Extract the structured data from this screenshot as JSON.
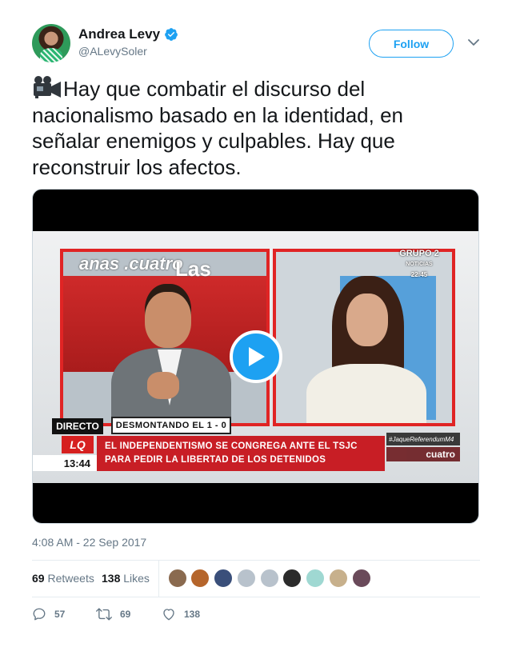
{
  "author": {
    "display_name": "Andrea Levy",
    "handle": "@ALevySoler",
    "verified_icon": "verified-badge-icon",
    "avatar_icon": "profile-avatar"
  },
  "header": {
    "follow_label": "Follow",
    "menu_icon": "chevron-down-icon"
  },
  "tweet": {
    "emoji_icon": "movie-camera-icon",
    "text": "Hay que combatir el discurso del nacionalismo basado en la identidad, en señalar enemigos y culpables. Hay que reconstruir los afectos."
  },
  "video": {
    "left_logo": "anas .cuatro",
    "left_logo2": "Las",
    "channel_badge_line1": "GRUPO 2",
    "channel_badge_line2": "NOTICIAS",
    "channel_badge_time": "22:45",
    "directo": "DIRECTO",
    "show_title": "DESMONTANDO EL 1 - 0",
    "hashtag": "#JaqueReferendumM4",
    "station_logo": "LQ",
    "clock": "13:44",
    "headline_line1": "EL INDEPENDENTISMO SE CONGREGA ANTE EL TSJC",
    "headline_line2": "PARA PEDIR LA LIBERTAD DE LOS DETENIDOS",
    "corner_logo": "cuatro",
    "play_icon": "play-icon"
  },
  "timestamp": "4:08 AM - 22 Sep 2017",
  "stats": {
    "retweets_count": "69",
    "retweets_label": "Retweets",
    "likes_count": "138",
    "likes_label": "Likes",
    "liker_avatar_colors": [
      "#8a6a4f",
      "#b5652b",
      "#3a4f7a",
      "#b8c2cc",
      "#b8c2cc",
      "#2b2b2b",
      "#9fd8d2",
      "#c7b08c",
      "#6a4a5a"
    ]
  },
  "actions": {
    "reply_count": "57",
    "retweet_count": "69",
    "like_count": "138"
  },
  "colors": {
    "accent": "#1da1f2",
    "muted": "#657786",
    "text": "#14171a",
    "tv_red": "#c81e25"
  }
}
